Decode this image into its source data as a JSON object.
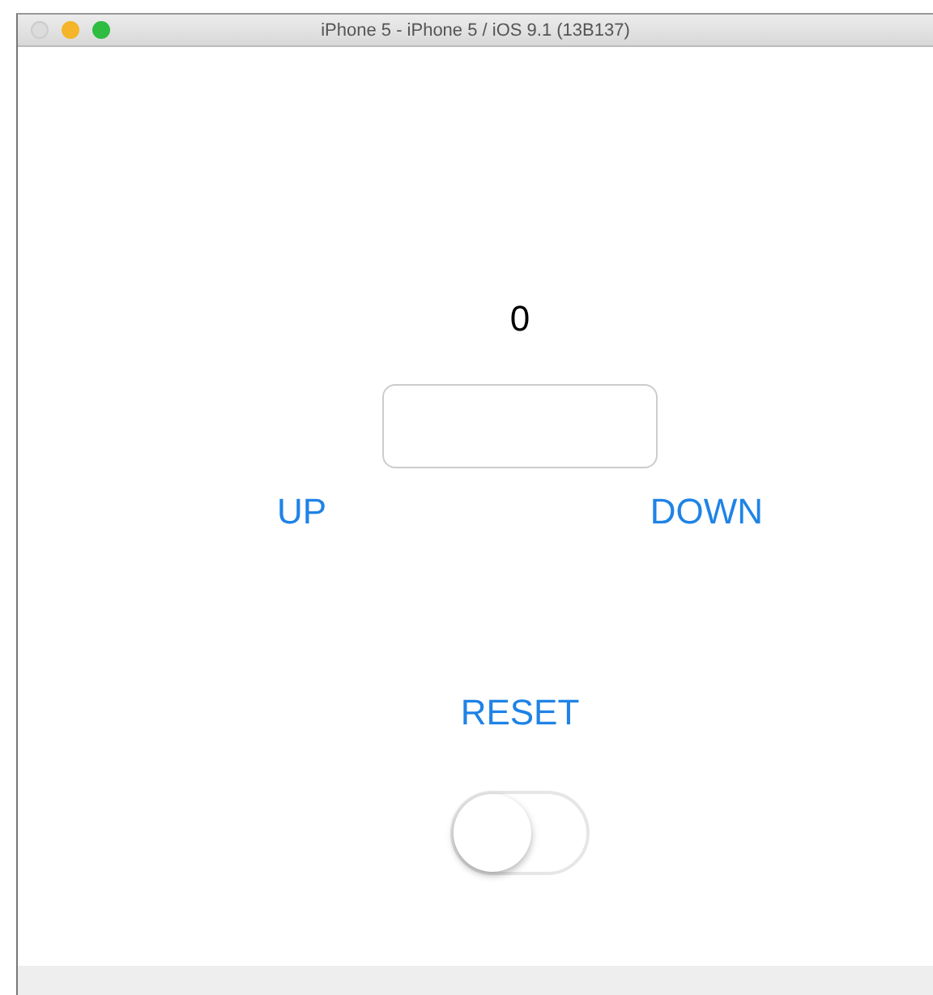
{
  "window": {
    "title": "iPhone 5 - iPhone 5 / iOS 9.1 (13B137)"
  },
  "counter": "0",
  "buttons": [
    {
      "label": "UP"
    },
    {
      "label": "DOWN"
    }
  ],
  "reset": "RESET",
  "switch": {
    "on": false
  }
}
